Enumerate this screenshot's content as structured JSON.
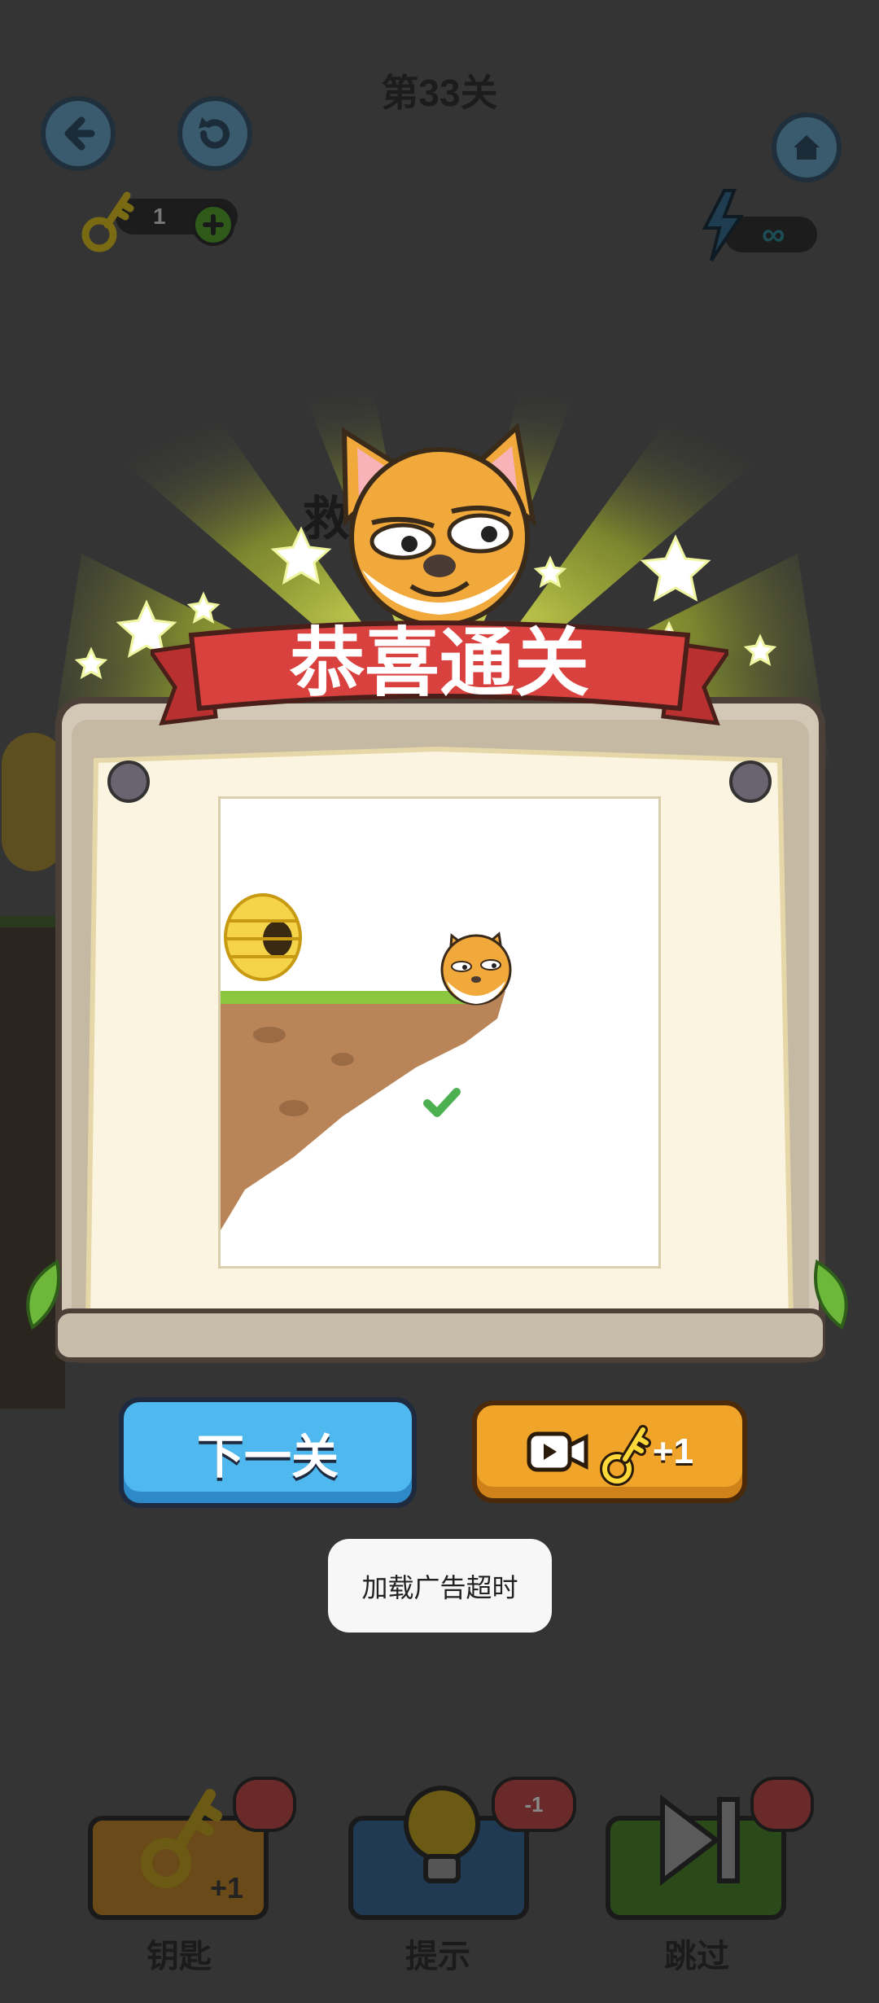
{
  "header": {
    "level_title": "第33关",
    "keys_count": "1",
    "energy_value": "∞"
  },
  "background": {
    "partial_text": "救"
  },
  "dialog": {
    "banner_title": "恭喜通关"
  },
  "actions": {
    "next_level_label": "下一关",
    "watch_ad_reward_label": "+1"
  },
  "toast": {
    "message": "加载广告超时"
  },
  "bottom_bar": {
    "items": [
      {
        "label": "钥匙",
        "badge": "+1",
        "icon": "key-icon"
      },
      {
        "label": "提示",
        "badge": "-1",
        "icon": "lightbulb-icon"
      },
      {
        "label": "跳过",
        "badge": "",
        "icon": "skip-icon"
      }
    ]
  },
  "colors": {
    "overlay_bg": "#343434",
    "ribbon_red": "#d9413f",
    "next_button_blue": "#4fb8ee",
    "ad_button_orange": "#f0a52a",
    "check_green": "#4caf50"
  }
}
